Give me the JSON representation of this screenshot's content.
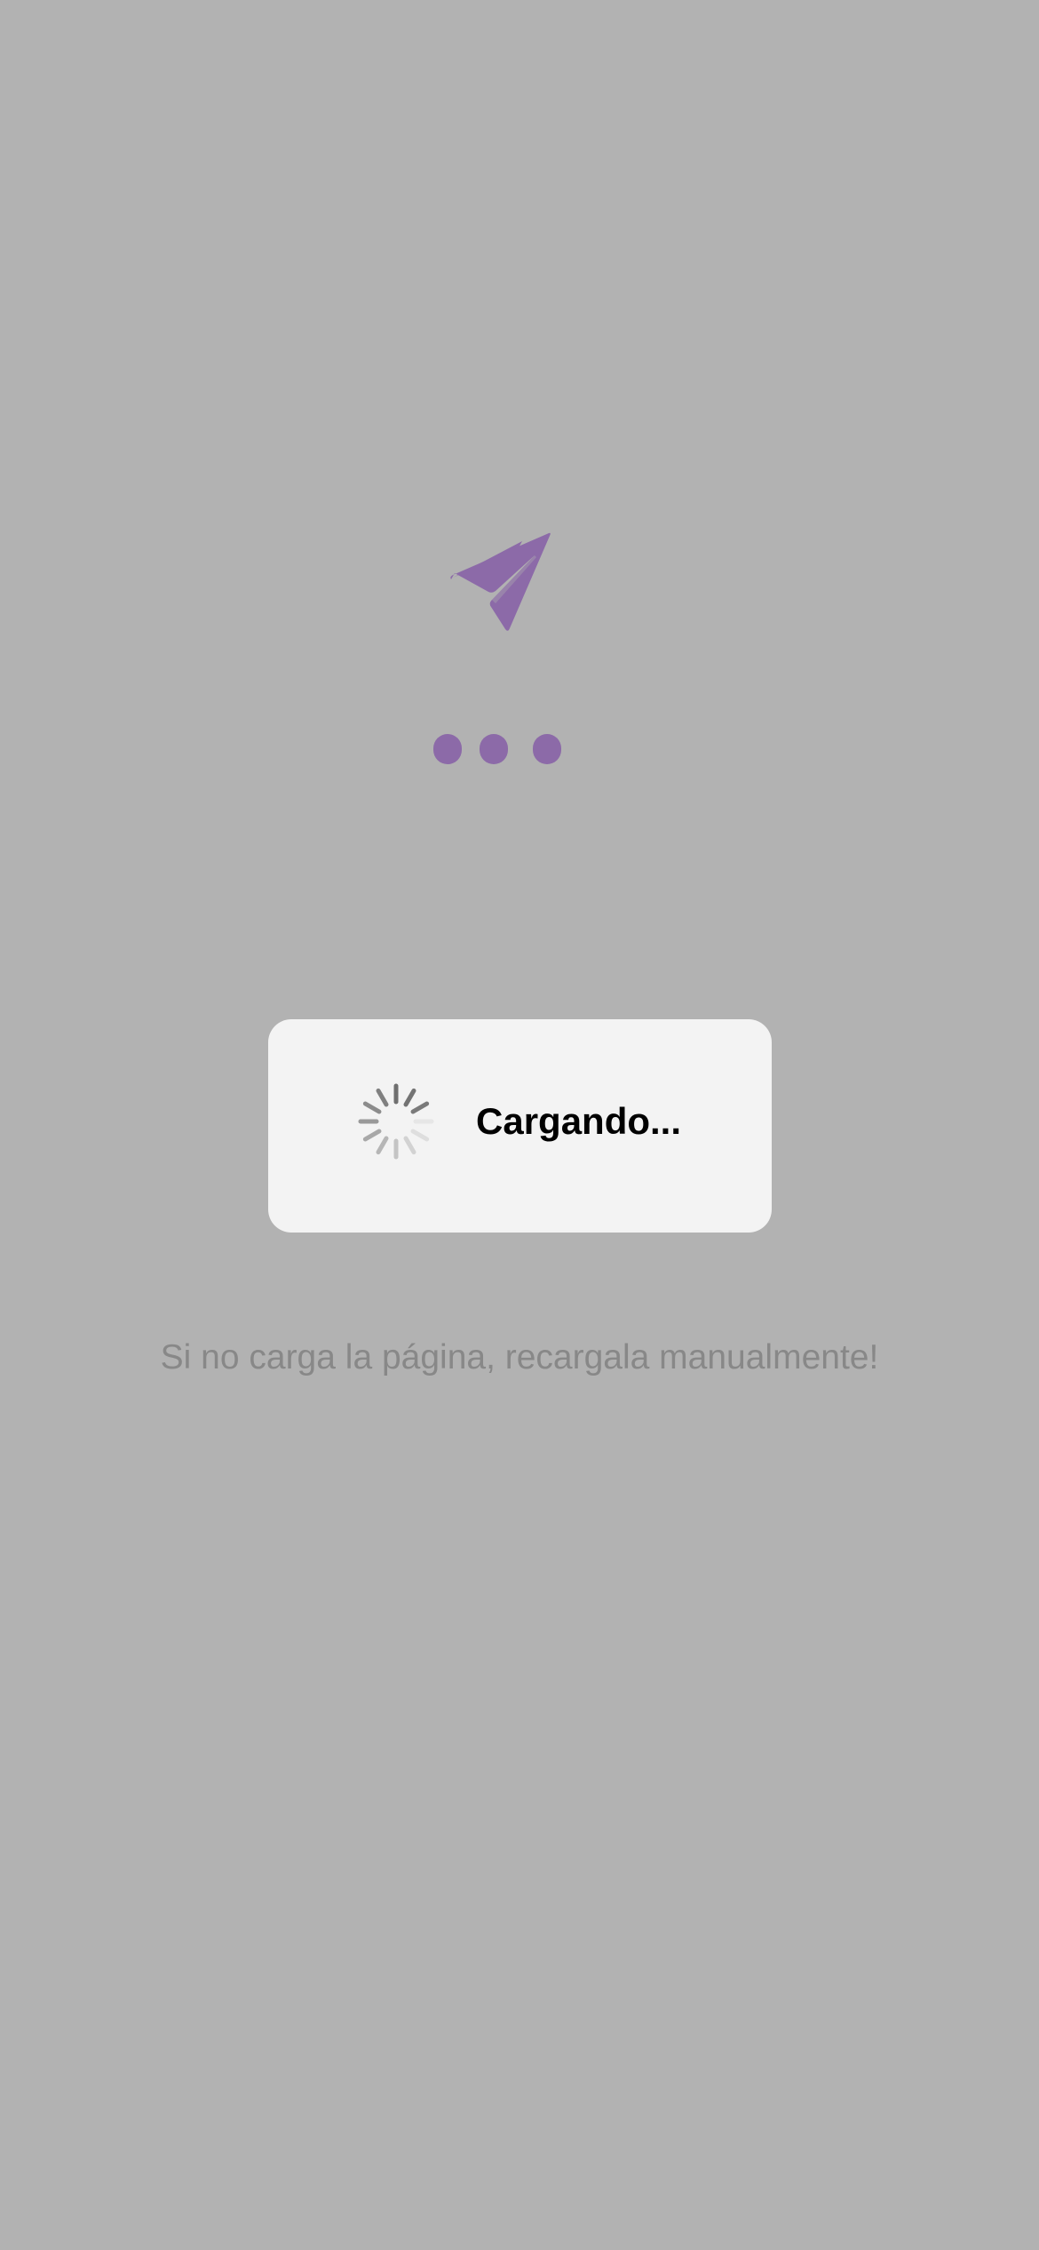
{
  "theme": {
    "background": "#b2b2b2",
    "accent": "#8c6aa8",
    "dialog_background": "#f3f3f3",
    "hint_color": "#888888"
  },
  "splash": {
    "logo_icon": "paper-plane-icon",
    "progress_indicator": "three-dots"
  },
  "loading_dialog": {
    "spinner_icon": "activity-spinner-icon",
    "label": "Cargando..."
  },
  "hint": {
    "text": "Si no carga la página, recargala manualmente!"
  }
}
